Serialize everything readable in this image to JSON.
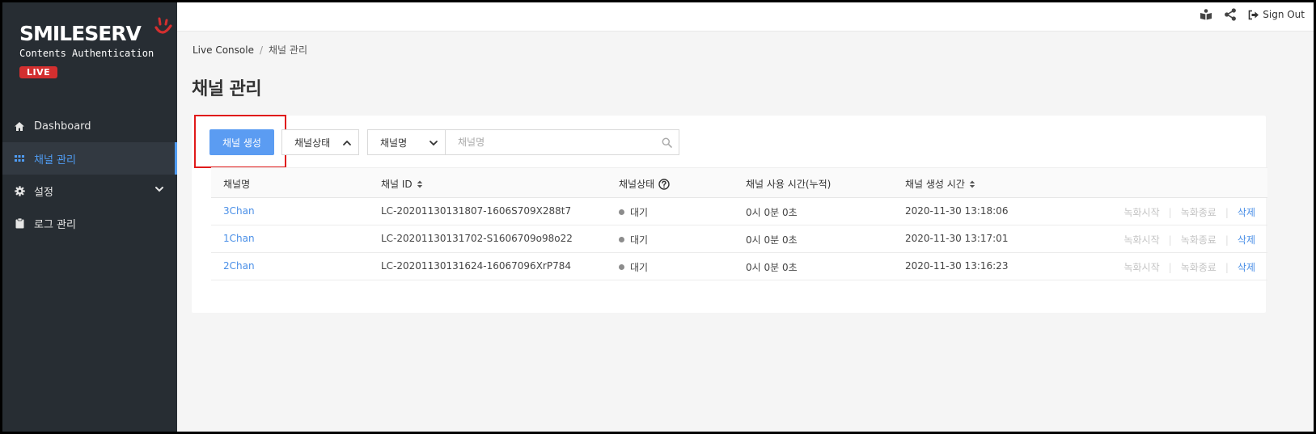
{
  "brand": {
    "logo_text": "SMILESERV",
    "subtitle": "Contents Authentication",
    "badge": "LIVE",
    "accent_color": "#d32f2f"
  },
  "sidebar": {
    "items": [
      {
        "label": "Dashboard",
        "icon": "home-icon",
        "active": false
      },
      {
        "label": "채널 관리",
        "icon": "grid-icon",
        "active": true
      },
      {
        "label": "설정",
        "icon": "gear-icon",
        "active": false,
        "expandable": true
      },
      {
        "label": "로그 관리",
        "icon": "clipboard-icon",
        "active": false
      }
    ]
  },
  "topbar": {
    "icons": [
      "book-icon",
      "share-icon"
    ],
    "signout_label": "Sign Out"
  },
  "breadcrumb": {
    "root": "Live Console",
    "separator": "/",
    "current": "채널 관리"
  },
  "page": {
    "title": "채널 관리"
  },
  "toolbar": {
    "create_label": "채널 생성",
    "status_select_label": "채널상태",
    "field_select_label": "채널명",
    "search_placeholder": "채널명"
  },
  "table": {
    "columns": [
      "채널명",
      "채널 ID",
      "채널상태",
      "채널 사용 시간(누적)",
      "채널 생성 시간"
    ],
    "rows": [
      {
        "name": "3Chan",
        "id": "LC-20201130131807-1606S709X288t7",
        "status": "대기",
        "usage": "0시 0분 0초",
        "created": "2020-11-30 13:18:06"
      },
      {
        "name": "1Chan",
        "id": "LC-20201130131702-S1606709o98o22",
        "status": "대기",
        "usage": "0시 0분 0초",
        "created": "2020-11-30 13:17:01"
      },
      {
        "name": "2Chan",
        "id": "LC-20201130131624-16067096XrP784",
        "status": "대기",
        "usage": "0시 0분 0초",
        "created": "2020-11-30 13:16:23"
      }
    ],
    "actions": {
      "record_start": "녹화시작",
      "record_stop": "녹화종료",
      "delete": "삭제"
    }
  },
  "colors": {
    "sidebar_bg": "#272d33",
    "primary": "#5b9cf2",
    "link": "#4a8fe7",
    "highlight": "#e01a1a"
  }
}
